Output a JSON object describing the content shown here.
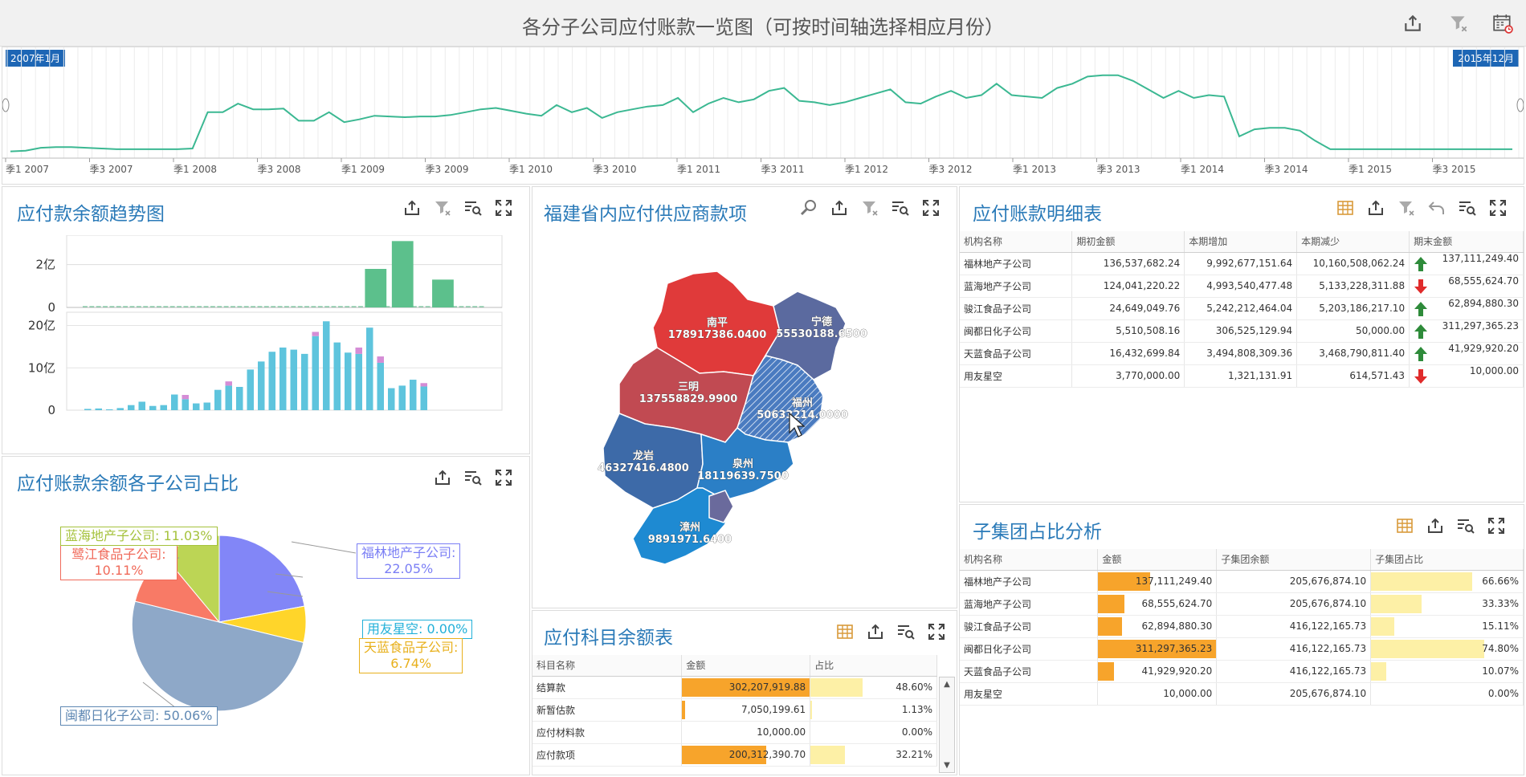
{
  "header": {
    "title": "各分子公司应付账款一览图（可按时间轴选择相应月份）",
    "tools": [
      "export-icon",
      "clear-filter-icon",
      "calendar-icon"
    ]
  },
  "timeline": {
    "start_label": "2007年1月",
    "end_label": "2015年12月",
    "ticks": [
      "季1 2007",
      "季3 2007",
      "季1 2008",
      "季3 2008",
      "季1 2009",
      "季3 2009",
      "季1 2010",
      "季3 2010",
      "季1 2011",
      "季3 2011",
      "季1 2012",
      "季3 2012",
      "季1 2013",
      "季3 2013",
      "季1 2014",
      "季3 2014",
      "季1 2015",
      "季3 2015"
    ],
    "values": [
      5,
      6,
      10,
      11,
      11,
      10,
      9,
      8,
      8,
      8,
      8,
      8,
      9,
      60,
      60,
      72,
      64,
      64,
      65,
      48,
      48,
      60,
      46,
      50,
      55,
      54,
      53,
      54,
      54,
      56,
      60,
      64,
      66,
      62,
      58,
      55,
      70,
      60,
      66,
      52,
      60,
      64,
      68,
      70,
      80,
      60,
      72,
      80,
      74,
      78,
      90,
      94,
      76,
      74,
      70,
      74,
      80,
      86,
      92,
      74,
      72,
      82,
      90,
      80,
      84,
      100,
      84,
      82,
      80,
      94,
      100,
      110,
      112,
      112,
      104,
      92,
      80,
      90,
      80,
      84,
      82,
      26,
      36,
      38,
      38,
      34,
      20,
      8,
      8,
      8,
      8,
      8,
      8,
      8,
      8,
      8,
      8,
      8,
      8,
      8
    ]
  },
  "trend_panel": {
    "title": "应付款余额趋势图",
    "tools": [
      "export-icon",
      "clear-filter-icon",
      "drill-icon",
      "fullscreen-icon"
    ]
  },
  "map_panel": {
    "title": "福建省内应付供应商款项",
    "tools": [
      "zoom-icon",
      "export-icon",
      "clear-filter-icon",
      "drill-icon",
      "fullscreen-icon"
    ],
    "regions": [
      {
        "name": "南平",
        "value": "178917386.0400",
        "color": "#e03a3a"
      },
      {
        "name": "宁德",
        "value": "55530188.6500",
        "color": "#5b6a9f"
      },
      {
        "name": "三明",
        "value": "137558829.9900",
        "color": "#c14a52"
      },
      {
        "name": "福州",
        "value": "50633214.0000",
        "color": "#3a72b2"
      },
      {
        "name": "龙岩",
        "value": "46327416.4800",
        "color": "#3d6aa8"
      },
      {
        "name": "泉州",
        "value": "18119639.7500",
        "color": "#2b7fc6"
      },
      {
        "name": "漳州",
        "value": "9891971.6400",
        "color": "#1e8ad2"
      }
    ]
  },
  "detail_panel": {
    "title": "应付账款明细表",
    "tools": [
      "grid-icon",
      "export-icon",
      "clear-filter-icon",
      "undo-icon",
      "drill-icon",
      "fullscreen-icon"
    ],
    "columns": [
      "机构名称",
      "期初金额",
      "本期增加",
      "本期减少",
      "期末金额"
    ],
    "rows": [
      {
        "name": "福林地产子公司",
        "open": "136,537,682.24",
        "inc": "9,992,677,151.64",
        "dec": "10,160,508,062.24",
        "trend": "up",
        "close": "137,111,249.40"
      },
      {
        "name": "蓝海地产子公司",
        "open": "124,041,220.22",
        "inc": "4,993,540,477.48",
        "dec": "5,133,228,311.88",
        "trend": "down",
        "close": "68,555,624.70"
      },
      {
        "name": "骏江食品子公司",
        "open": "24,649,049.76",
        "inc": "5,242,212,464.04",
        "dec": "5,203,186,217.10",
        "trend": "up",
        "close": "62,894,880.30"
      },
      {
        "name": "闽都日化子公司",
        "open": "5,510,508.16",
        "inc": "306,525,129.94",
        "dec": "50,000.00",
        "trend": "up",
        "close": "311,297,365.23"
      },
      {
        "name": "天蓝食品子公司",
        "open": "16,432,699.84",
        "inc": "3,494,808,309.36",
        "dec": "3,468,790,811.40",
        "trend": "up",
        "close": "41,929,920.20"
      },
      {
        "name": "用友星空",
        "open": "3,770,000.00",
        "inc": "1,321,131.91",
        "dec": "614,571.43",
        "trend": "down",
        "close": "10,000.00"
      }
    ]
  },
  "pie_panel": {
    "title": "应付账款余额各子公司占比",
    "tools": [
      "export-icon",
      "drill-icon",
      "fullscreen-icon"
    ],
    "labels": [
      {
        "text": "福林地产子公司:",
        "pct": "22.05%",
        "color": "#7b7ff5"
      },
      {
        "text": "用友星空:",
        "pct": "0.00%",
        "color": "#21b0d9"
      },
      {
        "text": "天蓝食品子公司:",
        "pct": "6.74%",
        "color": "#f4c623"
      },
      {
        "text": "闽都日化子公司:",
        "pct": "50.06%",
        "color": "#5f88b3"
      },
      {
        "text": "鹭江食品子公司:",
        "pct": "10.11%",
        "color": "#f06a5a"
      },
      {
        "text": "蓝海地产子公司:",
        "pct": "11.03%",
        "color": "#a5c23c"
      }
    ]
  },
  "chart_data": [
    {
      "type": "bar",
      "title": "",
      "ylabel_ticks": [
        "2亿",
        "0"
      ],
      "ylim": [
        0,
        3
      ],
      "color": "#5cc08c",
      "values": [
        0,
        0,
        0,
        0,
        0,
        0,
        0,
        0,
        0,
        0,
        0,
        0,
        0,
        0,
        0,
        0,
        0,
        0,
        0,
        0,
        0,
        0,
        0,
        0,
        0,
        0,
        0,
        0,
        0,
        0,
        0,
        0,
        0,
        0,
        0,
        0,
        0,
        0,
        0,
        0,
        0,
        0,
        1.8,
        0,
        0,
        0,
        3.1,
        0,
        0,
        0,
        0,
        0,
        1.3,
        0,
        0,
        0,
        0,
        0,
        0,
        0
      ]
    },
    {
      "type": "bar",
      "title": "",
      "ylabel_ticks": [
        "20亿",
        "10亿",
        "0"
      ],
      "ylim": [
        0,
        22
      ],
      "color": "#5ec4dd",
      "accent": "#d58dd6",
      "values": [
        0.3,
        0.4,
        0.2,
        0.5,
        1.2,
        2.0,
        1.0,
        1.2,
        3.7,
        2.6,
        1.6,
        1.8,
        4.8,
        5.8,
        5.5,
        9.6,
        11.5,
        13.8,
        14.8,
        14.3,
        13.3,
        17.5,
        21.0,
        16.0,
        13.6,
        13.3,
        19.5,
        11.2,
        5.2,
        5.8,
        7.2,
        5.6
      ],
      "accent_values": [
        0,
        0,
        0,
        0,
        0,
        0,
        0,
        0,
        0,
        1,
        0,
        0,
        0,
        1,
        0,
        0,
        0,
        0,
        0,
        0,
        0,
        1,
        0,
        0,
        0,
        1.5,
        0,
        1.5,
        0,
        0,
        0,
        0.8
      ]
    },
    {
      "type": "pie",
      "title": "",
      "slices": [
        {
          "name": "福林地产子公司",
          "value": 22.05,
          "color": "#8286f7"
        },
        {
          "name": "用友星空",
          "value": 0.0,
          "color": "#21b0d9"
        },
        {
          "name": "天蓝食品子公司",
          "value": 6.74,
          "color": "#ffd52a"
        },
        {
          "name": "闽都日化子公司",
          "value": 50.06,
          "color": "#8ea8c8"
        },
        {
          "name": "鹭江食品子公司",
          "value": 10.11,
          "color": "#f87a66"
        },
        {
          "name": "蓝海地产子公司",
          "value": 11.03,
          "color": "#bcd555"
        }
      ]
    }
  ],
  "subject_panel": {
    "title": "应付科目余额表",
    "tools": [
      "grid-icon",
      "export-icon",
      "drill-icon",
      "fullscreen-icon"
    ],
    "columns": [
      "科目名称",
      "金额",
      "占比"
    ],
    "rows": [
      {
        "name": "结算款",
        "amount": "302,207,919.88",
        "amount_pct": 100,
        "pct": "48.60%",
        "pct_val": 48.6
      },
      {
        "name": "新暂估款",
        "amount": "7,050,199.61",
        "amount_pct": 2.3,
        "pct": "1.13%",
        "pct_val": 1.13
      },
      {
        "name": "应付材料款",
        "amount": "10,000.00",
        "amount_pct": 0,
        "pct": "0.00%",
        "pct_val": 0
      },
      {
        "name": "应付款项",
        "amount": "200,312,390.70",
        "amount_pct": 66,
        "pct": "32.21%",
        "pct_val": 32.21
      }
    ]
  },
  "group_panel": {
    "title": "子集团占比分析",
    "tools": [
      "grid-icon",
      "export-icon",
      "drill-icon",
      "fullscreen-icon"
    ],
    "columns": [
      "机构名称",
      "金额",
      "子集团余额",
      "子集团占比"
    ],
    "rows": [
      {
        "name": "福林地产子公司",
        "amount": "137,111,249.40",
        "amount_pct": 44,
        "group": "205,676,874.10",
        "ratio": "66.66%",
        "ratio_val": 66.66
      },
      {
        "name": "蓝海地产子公司",
        "amount": "68,555,624.70",
        "amount_pct": 22,
        "group": "205,676,874.10",
        "ratio": "33.33%",
        "ratio_val": 33.33
      },
      {
        "name": "骏江食品子公司",
        "amount": "62,894,880.30",
        "amount_pct": 20,
        "group": "416,122,165.73",
        "ratio": "15.11%",
        "ratio_val": 15.11
      },
      {
        "name": "闽都日化子公司",
        "amount": "311,297,365.23",
        "amount_pct": 100,
        "group": "416,122,165.73",
        "ratio": "74.80%",
        "ratio_val": 74.8
      },
      {
        "name": "天蓝食品子公司",
        "amount": "41,929,920.20",
        "amount_pct": 13.5,
        "group": "416,122,165.73",
        "ratio": "10.07%",
        "ratio_val": 10.07
      },
      {
        "name": "用友星空",
        "amount": "10,000.00",
        "amount_pct": 0,
        "group": "205,676,874.10",
        "ratio": "0.00%",
        "ratio_val": 0
      }
    ]
  }
}
